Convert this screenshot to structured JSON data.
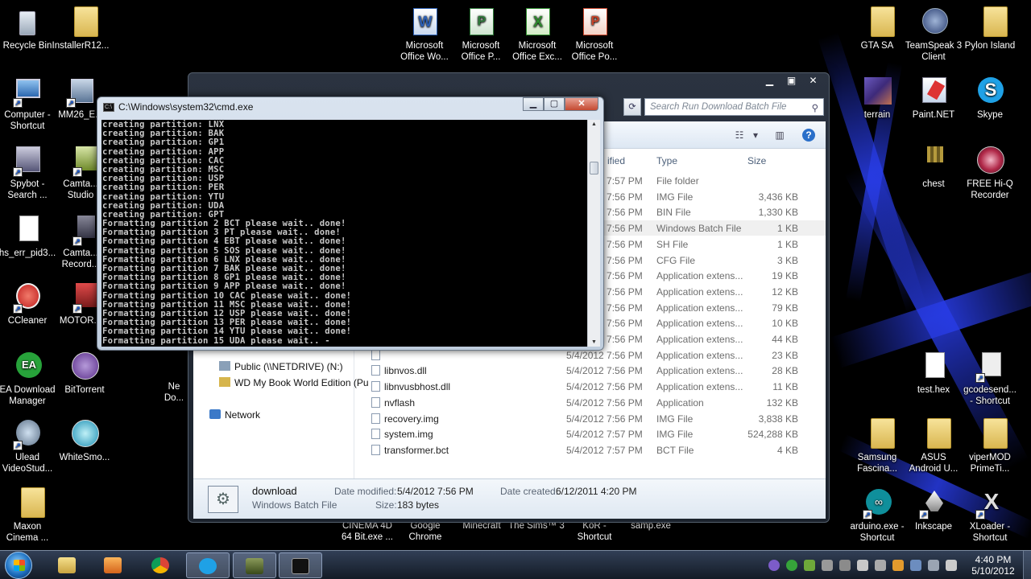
{
  "desktop": {
    "icons": [
      {
        "id": "recycle",
        "label": "Recycle Bin"
      },
      {
        "id": "installer",
        "label": "InstallerR12..."
      },
      {
        "id": "word",
        "label": "Microsoft\nOffice Wo..."
      },
      {
        "id": "powerpoint",
        "label": "Microsoft\nOffice P..."
      },
      {
        "id": "excel",
        "label": "Microsoft\nOffice Exc..."
      },
      {
        "id": "publisher",
        "label": "Microsoft\nOffice Po..."
      },
      {
        "id": "gtasa",
        "label": "GTA SA"
      },
      {
        "id": "teamspeak",
        "label": "TeamSpeak 3\nClient"
      },
      {
        "id": "pylon",
        "label": "Pylon Island"
      },
      {
        "id": "computer",
        "label": "Computer -\nShortcut"
      },
      {
        "id": "mm26",
        "label": "MM26_E..."
      },
      {
        "id": "terrain",
        "label": "terrain"
      },
      {
        "id": "paintnet",
        "label": "Paint.NET"
      },
      {
        "id": "skype",
        "label": "Skype"
      },
      {
        "id": "spybot",
        "label": "Spybot -\nSearch ..."
      },
      {
        "id": "camtasia1",
        "label": "Camta...\nStudio"
      },
      {
        "id": "chest",
        "label": "chest"
      },
      {
        "id": "freehiq",
        "label": "FREE Hi-Q\nRecorder"
      },
      {
        "id": "hserr",
        "label": "hs_err_pid3..."
      },
      {
        "id": "camtasia2",
        "label": "Camta...\nRecord..."
      },
      {
        "id": "ccleaner",
        "label": "CCleaner"
      },
      {
        "id": "motor",
        "label": "MOTOR..."
      },
      {
        "id": "eadownload",
        "label": "EA Download\nManager"
      },
      {
        "id": "bittorrent",
        "label": "BitTorrent"
      },
      {
        "id": "ne",
        "label": "Ne\nDo..."
      },
      {
        "id": "testhex",
        "label": "test.hex"
      },
      {
        "id": "gcodesend",
        "label": "gcodesend...\n- Shortcut"
      },
      {
        "id": "ulead",
        "label": "Ulead\nVideoStud..."
      },
      {
        "id": "whitesmoke",
        "label": "WhiteSmo..."
      },
      {
        "id": "samsung",
        "label": "Samsung\nFascina..."
      },
      {
        "id": "asus",
        "label": "ASUS\nAndroid U..."
      },
      {
        "id": "vipermod",
        "label": "viperMOD\nPrimeTi..."
      },
      {
        "id": "maxon",
        "label": "Maxon\nCinema ..."
      },
      {
        "id": "arduino",
        "label": "arduino.exe -\nShortcut"
      },
      {
        "id": "inkscape",
        "label": "Inkscape"
      },
      {
        "id": "xloader",
        "label": "XLoader -\nShortcut"
      }
    ],
    "bottom_labels": [
      {
        "id": "cinema4d",
        "label": "CINEMA 4D\n64 Bit.exe ..."
      },
      {
        "id": "chrome",
        "label": "Google\nChrome"
      },
      {
        "id": "minecraft",
        "label": "Minecraft"
      },
      {
        "id": "sims3",
        "label": "The Sims™ 3"
      },
      {
        "id": "kor",
        "label": "KoR -\nShortcut"
      },
      {
        "id": "samp",
        "label": "samp.exe"
      }
    ]
  },
  "explorer": {
    "search_placeholder": "Search Run Download Batch File",
    "columns": {
      "modified": "ified",
      "type": "Type",
      "size": "Size"
    },
    "nav": [
      {
        "label": "Public (\\\\NETDRIVE) (N:)"
      },
      {
        "label": "WD My Book World Edition (Pu"
      },
      {
        "label": "Network"
      }
    ],
    "rows": [
      {
        "name": "",
        "date": "5/4/2012 7:57 PM",
        "type": "File folder",
        "size": ""
      },
      {
        "name": "",
        "date": "5/4/2012 7:56 PM",
        "type": "IMG File",
        "size": "3,436 KB"
      },
      {
        "name": "",
        "date": "5/4/2012 7:56 PM",
        "type": "BIN File",
        "size": "1,330 KB"
      },
      {
        "name": "",
        "date": "5/4/2012 7:56 PM",
        "type": "Windows Batch File",
        "size": "1 KB"
      },
      {
        "name": "",
        "date": "5/4/2012 7:56 PM",
        "type": "SH File",
        "size": "1 KB"
      },
      {
        "name": "",
        "date": "5/4/2012 7:56 PM",
        "type": "CFG File",
        "size": "3 KB"
      },
      {
        "name": "",
        "date": "5/4/2012 7:56 PM",
        "type": "Application extens...",
        "size": "19 KB"
      },
      {
        "name": "",
        "date": "5/4/2012 7:56 PM",
        "type": "Application extens...",
        "size": "12 KB"
      },
      {
        "name": "",
        "date": "5/4/2012 7:56 PM",
        "type": "Application extens...",
        "size": "79 KB"
      },
      {
        "name": "",
        "date": "5/4/2012 7:56 PM",
        "type": "Application extens...",
        "size": "10 KB"
      },
      {
        "name": "",
        "date": "5/4/2012 7:56 PM",
        "type": "Application extens...",
        "size": "44 KB"
      },
      {
        "name": "",
        "date": "5/4/2012 7:56 PM",
        "type": "Application extens...",
        "size": "23 KB"
      },
      {
        "name": "libnvos.dll",
        "date": "5/4/2012 7:56 PM",
        "type": "Application extens...",
        "size": "28 KB"
      },
      {
        "name": "libnvusbhost.dll",
        "date": "5/4/2012 7:56 PM",
        "type": "Application extens...",
        "size": "11 KB"
      },
      {
        "name": "nvflash",
        "date": "5/4/2012 7:56 PM",
        "type": "Application",
        "size": "132 KB"
      },
      {
        "name": "recovery.img",
        "date": "5/4/2012 7:56 PM",
        "type": "IMG File",
        "size": "3,838 KB"
      },
      {
        "name": "system.img",
        "date": "5/4/2012 7:57 PM",
        "type": "IMG File",
        "size": "524,288 KB"
      },
      {
        "name": "transformer.bct",
        "date": "5/4/2012 7:57 PM",
        "type": "BCT File",
        "size": "4 KB"
      }
    ],
    "details": {
      "name": "download",
      "type": "Windows Batch File",
      "modified_label": "Date modified:",
      "modified_value": "5/4/2012 7:56 PM",
      "created_label": "Date created:",
      "created_value": "6/12/2011 4:20 PM",
      "size_label": "Size:",
      "size_value": "183 bytes"
    }
  },
  "cmd": {
    "title": "C:\\Windows\\system32\\cmd.exe",
    "lines": [
      "creating partition: LNX",
      "creating partition: BAK",
      "creating partition: GP1",
      "creating partition: APP",
      "creating partition: CAC",
      "creating partition: MSC",
      "creating partition: USP",
      "creating partition: PER",
      "creating partition: YTU",
      "creating partition: UDA",
      "creating partition: GPT",
      "Formatting partition 2 BCT please wait.. done!",
      "Formatting partition 3 PT please wait.. done!",
      "Formatting partition 4 EBT please wait.. done!",
      "Formatting partition 5 SOS please wait.. done!",
      "Formatting partition 6 LNX please wait.. done!",
      "Formatting partition 7 BAK please wait.. done!",
      "Formatting partition 8 GP1 please wait.. done!",
      "Formatting partition 9 APP please wait.. done!",
      "Formatting partition 10 CAC please wait.. done!",
      "Formatting partition 11 MSC please wait.. done!",
      "Formatting partition 12 USP please wait.. done!",
      "Formatting partition 13 PER please wait.. done!",
      "Formatting partition 14 YTU please wait.. done!",
      "Formatting partition 15 UDA please wait.. -"
    ]
  },
  "taskbar": {
    "time": "4:40 PM",
    "date": "5/10/2012",
    "buttons": [
      "explorer",
      "media-player",
      "chrome",
      "skype",
      "unknown-app",
      "cmd"
    ]
  },
  "colors": {
    "desktop_bg": "#000000",
    "beam": "#2a3fe0",
    "cmd_text": "#c8c8c8",
    "selection": "#f0f0f0"
  }
}
